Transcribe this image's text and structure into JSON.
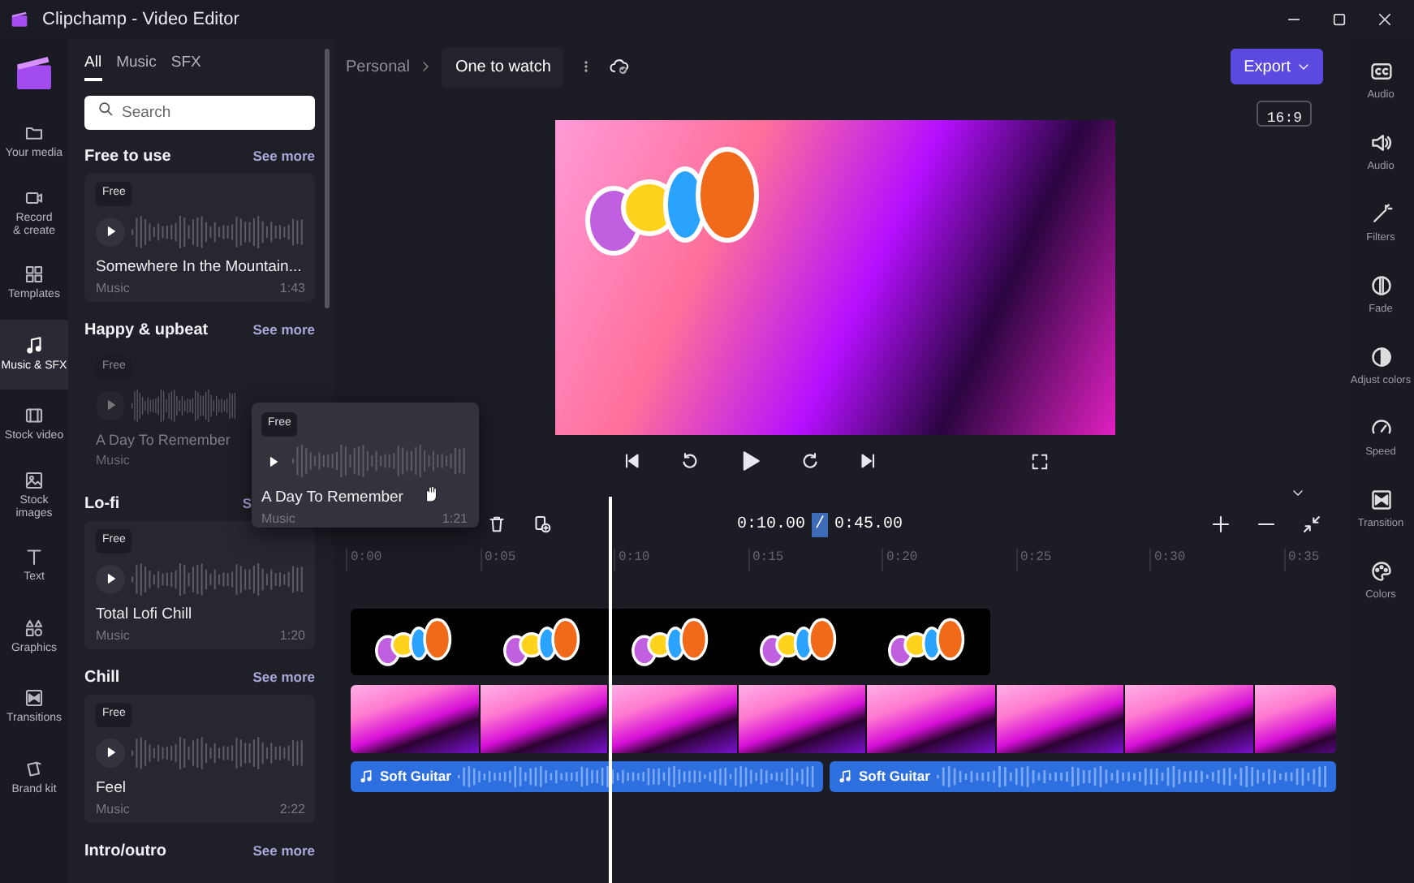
{
  "window": {
    "title": "Clipchamp - Video Editor"
  },
  "nav": [
    {
      "label": "Your media",
      "selected": false
    },
    {
      "label": "Record\n& create",
      "selected": false
    },
    {
      "label": "Templates",
      "selected": false
    },
    {
      "label": "Music & SFX",
      "selected": true
    },
    {
      "label": "Stock video",
      "selected": false
    },
    {
      "label": "Stock images",
      "selected": false
    },
    {
      "label": "Text",
      "selected": false
    },
    {
      "label": "Graphics",
      "selected": false
    },
    {
      "label": "Transitions",
      "selected": false
    },
    {
      "label": "Brand kit",
      "selected": false
    }
  ],
  "library": {
    "tabs": [
      {
        "label": "All",
        "selected": true
      },
      {
        "label": "Music",
        "selected": false
      },
      {
        "label": "SFX",
        "selected": false
      }
    ],
    "search": {
      "placeholder": "Search"
    },
    "sections": [
      {
        "title": "Free to use",
        "see_more": "See more",
        "tracks": [
          {
            "badge": "Free",
            "title": "Somewhere In the Mountain...",
            "genre": "Music",
            "duration": "1:43",
            "dragging": false
          }
        ]
      },
      {
        "title": "Happy & upbeat",
        "see_more": "See more",
        "tracks": [
          {
            "badge": "Free",
            "title": "A Day To Remember",
            "genre": "Music",
            "dragging": true
          }
        ]
      },
      {
        "title": "Lo-fi",
        "see_more": "S",
        "covered": true,
        "tracks": [
          {
            "badge": "Free",
            "title": "Total Lofi Chill",
            "genre": "Music",
            "duration": "1:20",
            "dragging": false
          }
        ]
      },
      {
        "title": "Chill",
        "see_more": "See more",
        "tracks": [
          {
            "badge": "Free",
            "title": "Feel",
            "genre": "Music",
            "duration": "2:22",
            "dragging": false
          }
        ]
      },
      {
        "title": "Intro/outro",
        "see_more": "See more"
      }
    ]
  },
  "drag_card": {
    "badge": "Free",
    "title": "A Day To Remember",
    "genre": "Music",
    "duration": "1:21"
  },
  "header": {
    "breadcrumb": "Personal",
    "project": "One to watch",
    "export": "Export"
  },
  "aspect_ratio": "16:9",
  "timeline": {
    "current_time": "0:10.00",
    "separator": "/",
    "total_time": "0:45.00",
    "ruler": [
      "0:00",
      "0:05",
      "0:10",
      "0:15",
      "0:20",
      "0:25",
      "0:30",
      "0:35"
    ],
    "audio_clips": [
      {
        "label": "Soft Guitar"
      },
      {
        "label": "Soft Guitar"
      }
    ]
  },
  "right_rail": [
    {
      "label": "Audio"
    },
    {
      "label": "Audio"
    },
    {
      "label": "Filters"
    },
    {
      "label": "Fade"
    },
    {
      "label": "Adjust colors"
    },
    {
      "label": "Speed"
    },
    {
      "label": "Transition"
    },
    {
      "label": "Colors"
    }
  ]
}
